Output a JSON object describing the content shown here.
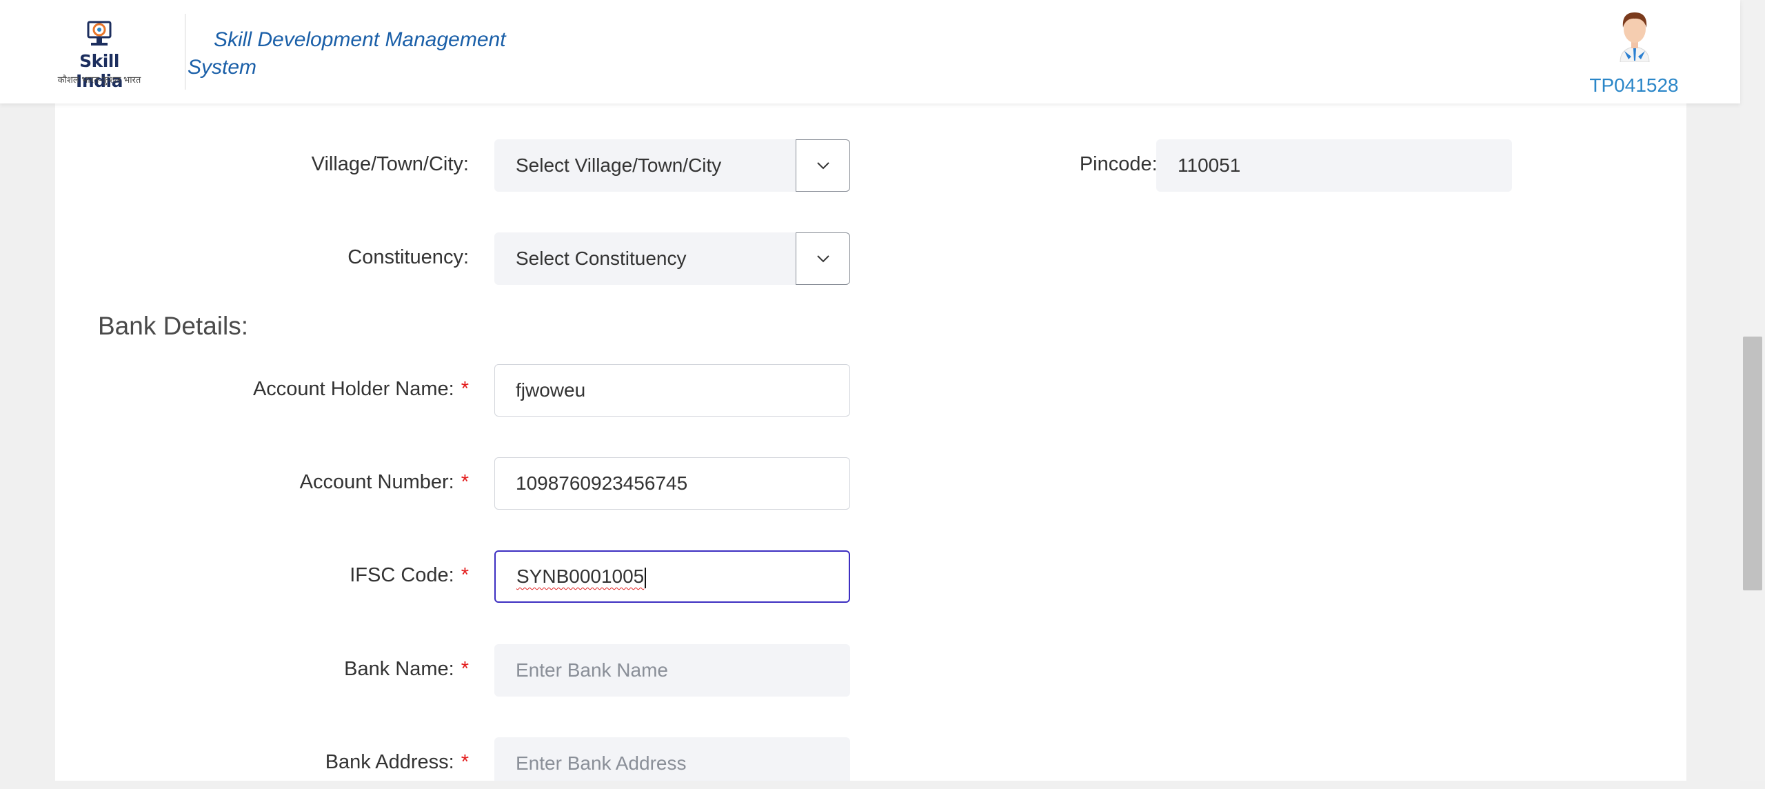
{
  "header": {
    "logo_brand": "Skill India",
    "logo_tagline": "कौशल भारत-कुशल भारत",
    "app_title": "Skill Development Management System",
    "user_id": "TP041528"
  },
  "address": {
    "village_label": "Village/Town/City:",
    "village_value": "Select Village/Town/City",
    "pincode_label": "Pincode:",
    "pincode_value": "110051",
    "constituency_label": "Constituency:",
    "constituency_value": "Select Constituency"
  },
  "bank": {
    "section_title": "Bank Details:",
    "holder_label": "Account Holder Name:",
    "holder_value": "fjwoweu",
    "account_label": "Account Number:",
    "account_value": "1098760923456745",
    "ifsc_label": "IFSC Code:",
    "ifsc_value": "SYNB0001005",
    "bank_name_label": "Bank Name:",
    "bank_name_placeholder": "Enter Bank Name",
    "bank_address_label": "Bank Address:",
    "bank_address_placeholder": "Enter Bank Address"
  },
  "required_mark": "*",
  "colors": {
    "accent": "#1a5fa8",
    "user_id": "#2a86c8",
    "required": "#e31b1b",
    "focus_border": "#3d2fc1"
  }
}
